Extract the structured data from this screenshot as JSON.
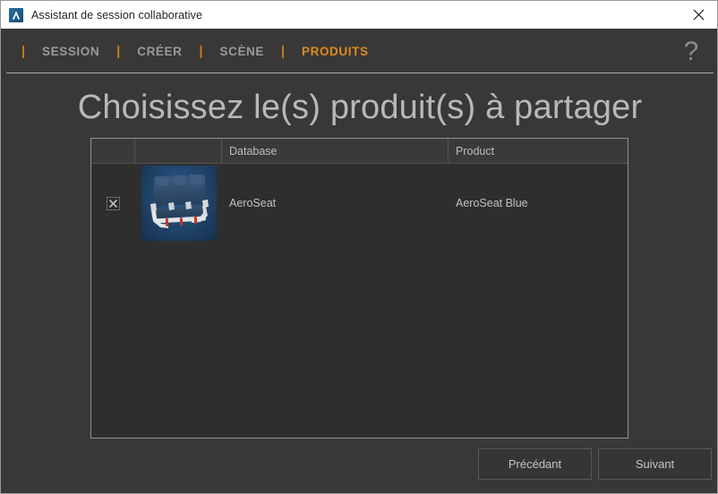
{
  "window": {
    "title": "Assistant de session collaborative",
    "icon": "autodesk-a-icon",
    "close_label": "✕"
  },
  "nav": {
    "separator": "|",
    "help_label": "?",
    "active_color": "#e08a1e",
    "tabs": [
      {
        "label": "SESSION",
        "active": false
      },
      {
        "label": "CRÉER",
        "active": false
      },
      {
        "label": "SCÈNE",
        "active": false
      },
      {
        "label": "PRODUITS",
        "active": true
      }
    ]
  },
  "page": {
    "title": "Choisissez le(s) produit(s) à partager"
  },
  "table": {
    "columns": [
      {
        "key": "check",
        "label": ""
      },
      {
        "key": "thumb",
        "label": ""
      },
      {
        "key": "database",
        "label": "Database"
      },
      {
        "key": "product",
        "label": "Product"
      }
    ],
    "rows": [
      {
        "checked": true,
        "check_glyph": "✖",
        "thumbnail": "aeroseat-triple-seat-render",
        "database": "AeroSeat",
        "product": "AeroSeat Blue"
      }
    ]
  },
  "footer": {
    "previous_label": "Précédant",
    "next_label": "Suivant"
  }
}
